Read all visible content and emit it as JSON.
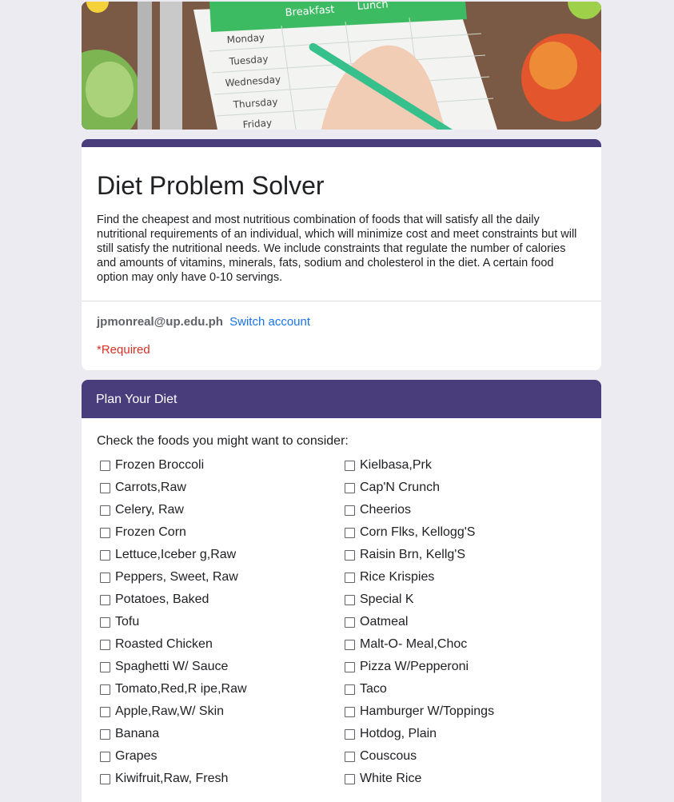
{
  "banner": {
    "days": [
      "Monday",
      "Tuesday",
      "Wednesday",
      "Thursday",
      "Friday"
    ],
    "meals": [
      "Breakfast",
      "Lunch"
    ]
  },
  "form": {
    "title": "Diet Problem Solver",
    "description": "Find the cheapest and most nutritious combination of foods that will satisfy all the daily nutritional requirements of an individual, which will minimize cost and meet constraints but will still satisfy the nutritional needs. We include constraints that regulate the number of calories and amounts of vitamins, minerals, fats, sodium and cholesterol in the diet. A certain food option may only have 0-10 servings.",
    "account_email": "jpmonreal@up.edu.ph",
    "switch_account": "Switch account",
    "required_note": "*Required"
  },
  "section": {
    "title": "Plan Your Diet",
    "question": "Check the foods you might want to consider:",
    "left_options": [
      "Frozen Broccoli",
      "Carrots,Raw",
      "Celery, Raw",
      "Frozen Corn",
      "Lettuce,Iceber g,Raw",
      "Peppers, Sweet, Raw",
      "Potatoes, Baked",
      "Tofu",
      "Roasted Chicken",
      "Spaghetti W/ Sauce",
      "Tomato,Red,R ipe,Raw",
      "Apple,Raw,W/ Skin",
      "Banana",
      "Grapes",
      "Kiwifruit,Raw, Fresh"
    ],
    "right_options": [
      "Kielbasa,Prk",
      "Cap'N Crunch",
      "Cheerios",
      "Corn Flks, Kellogg'S",
      "Raisin Brn, Kellg'S",
      "Rice Krispies",
      "Special K",
      "Oatmeal",
      "Malt-O- Meal,Choc",
      "Pizza W/Pepperoni",
      "Taco",
      "Hamburger W/Toppings",
      "Hotdog, Plain",
      "Couscous",
      "White Rice"
    ]
  },
  "colors": {
    "accent": "#4a3d7c",
    "link": "#1a73e8",
    "required": "#d93025",
    "background": "#ecebf1"
  }
}
